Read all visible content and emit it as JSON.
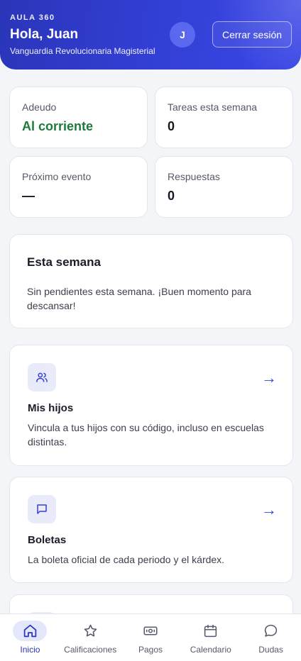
{
  "header": {
    "brand": "AULA 360",
    "greeting": "Hola, Juan",
    "school": "Vanguardia Revolucionaria Magisterial",
    "avatar_initial": "J",
    "logout_label": "Cerrar sesión"
  },
  "stats": [
    {
      "label": "Adeudo",
      "value": "Al corriente",
      "status_color": "#1e7a3a"
    },
    {
      "label": "Tareas esta semana",
      "value": "0"
    },
    {
      "label": "Próximo evento",
      "value": "—"
    },
    {
      "label": "Respuestas",
      "value": "0"
    }
  ],
  "this_week": {
    "title": "Esta semana",
    "text": "Sin pendientes esta semana. ¡Buen momento para descansar!"
  },
  "features": [
    {
      "icon": "users-icon",
      "title": "Mis hijos",
      "description": "Vincula a tus hijos con su código, incluso en escuelas distintas.",
      "arrow": "→"
    },
    {
      "icon": "message-square-icon",
      "title": "Boletas",
      "description": "La boleta oficial de cada periodo y el kárdex.",
      "arrow": "→"
    }
  ],
  "nav": [
    {
      "label": "Inicio",
      "icon": "home-icon",
      "active": true
    },
    {
      "label": "Calificaciones",
      "icon": "star-icon",
      "active": false
    },
    {
      "label": "Pagos",
      "icon": "banknote-icon",
      "active": false
    },
    {
      "label": "Calendario",
      "icon": "calendar-icon",
      "active": false
    },
    {
      "label": "Dudas",
      "icon": "chat-bubble-icon",
      "active": false
    }
  ],
  "colors": {
    "accent": "#3340d6",
    "header_gradient_start": "#2a35b8",
    "header_gradient_end": "#3a46e6",
    "success": "#1e7a3a"
  }
}
